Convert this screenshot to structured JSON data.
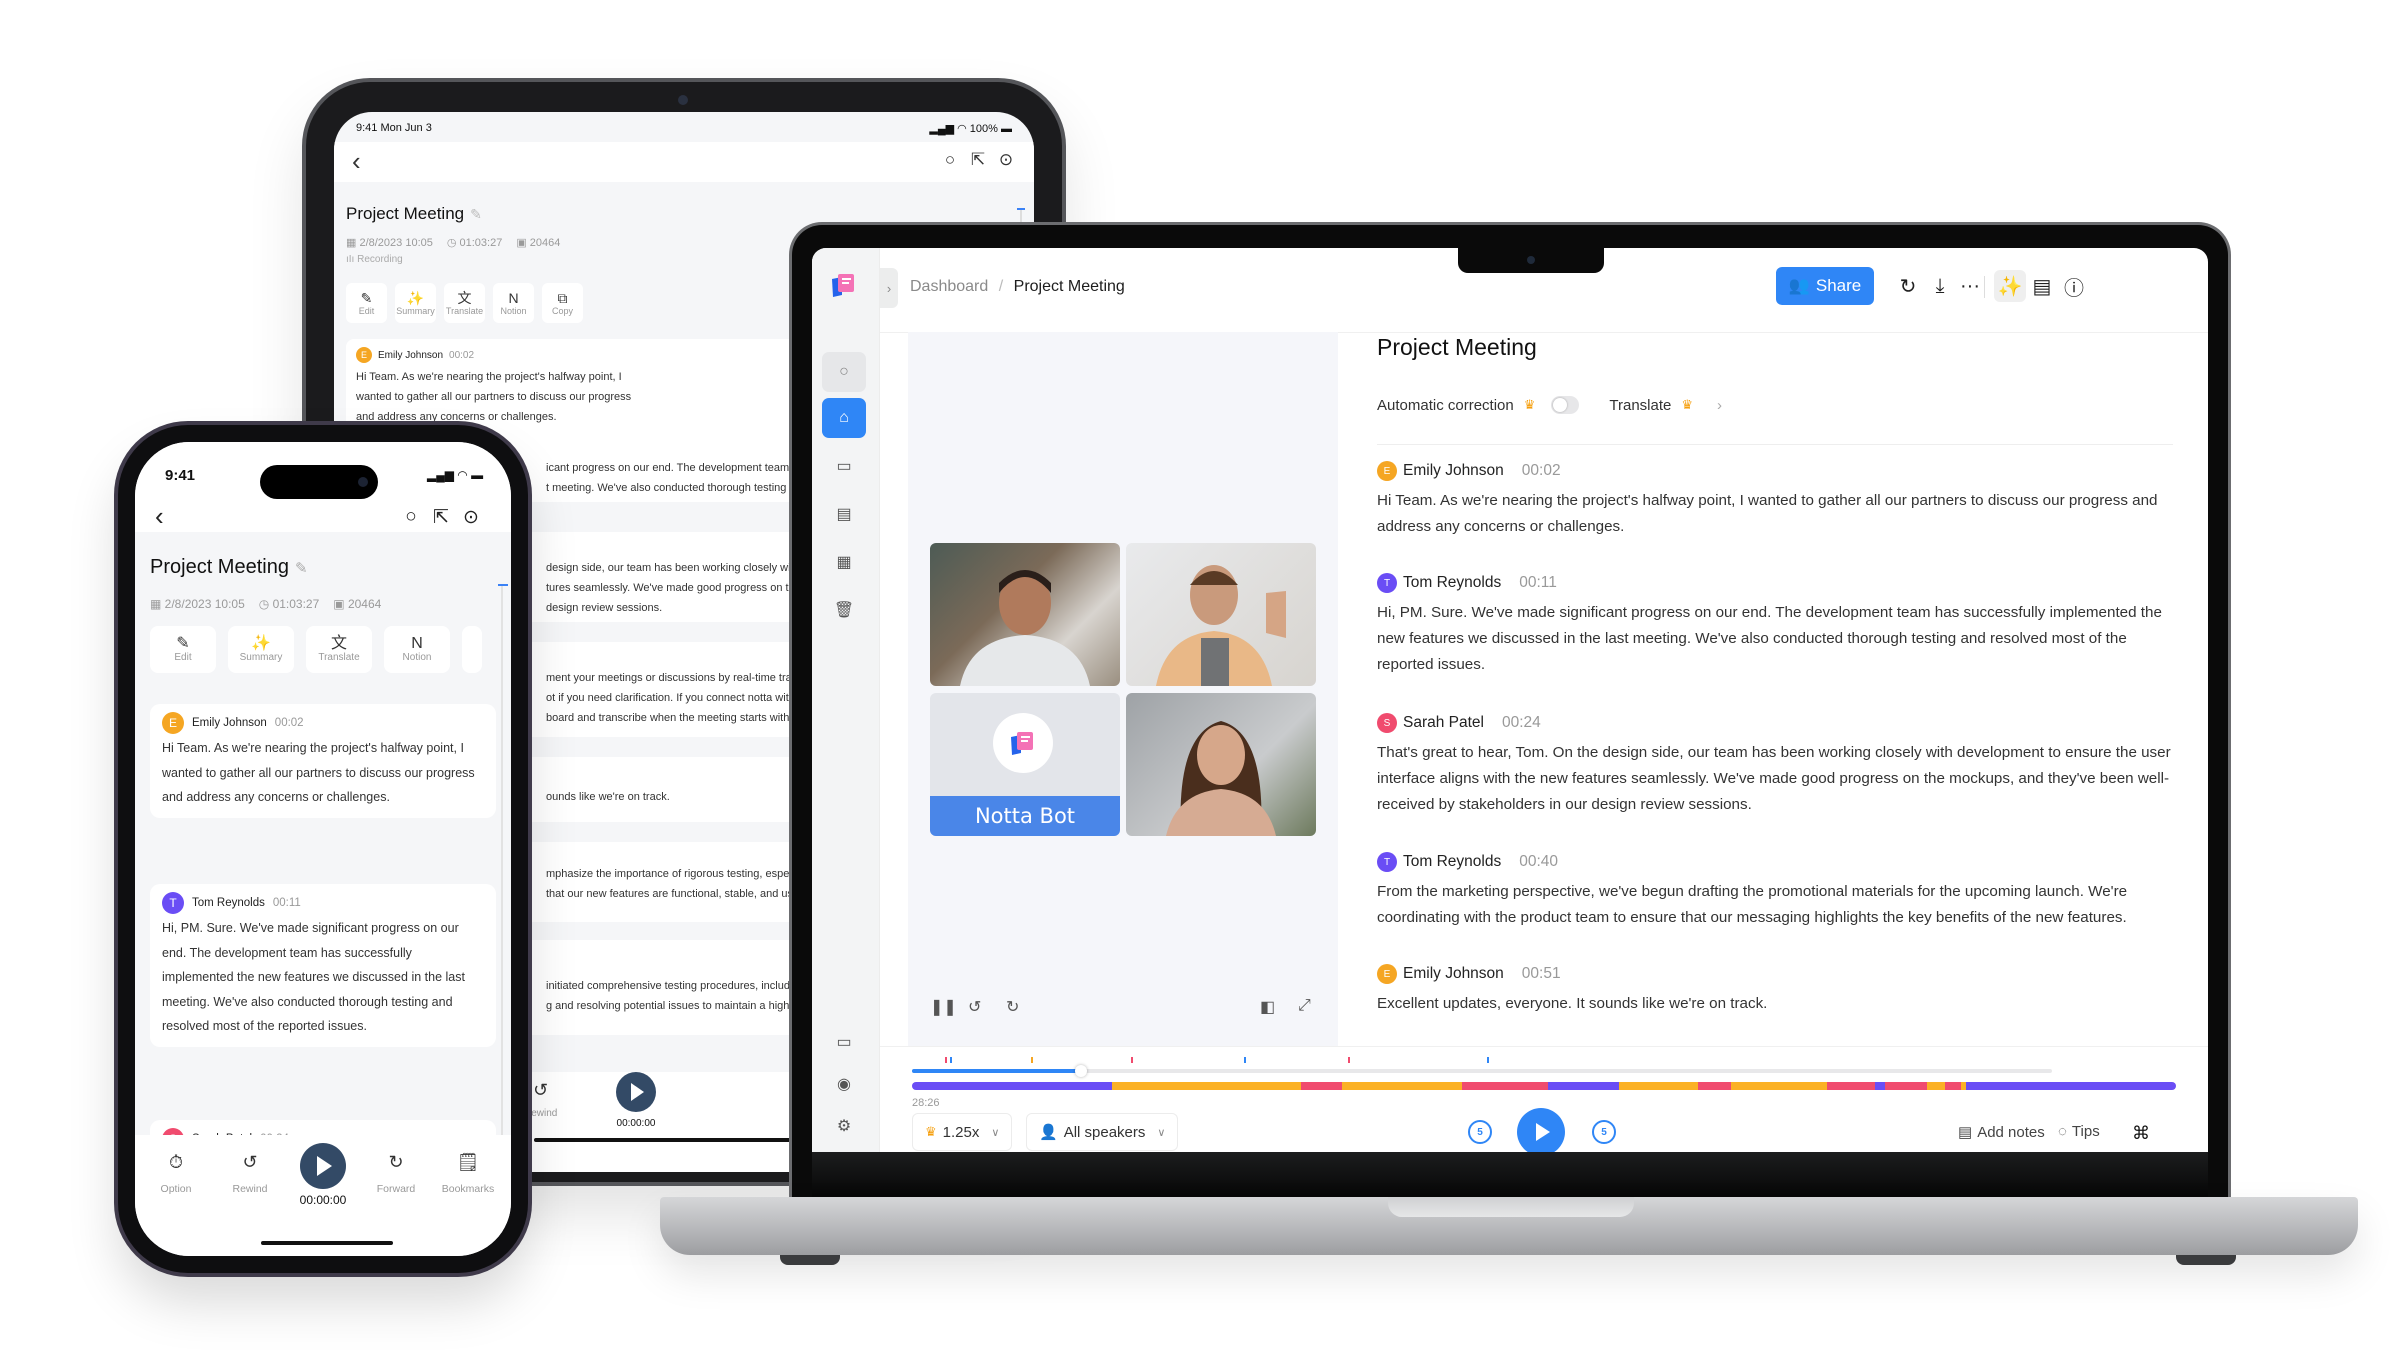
{
  "tablet": {
    "status_time": "9:41 Mon Jun 3",
    "status_battery": "100%",
    "title": "Project Meeting",
    "meta": {
      "date": "2/8/2023 10:05",
      "duration": "01:03:27",
      "words": "20464"
    },
    "recording_label": "Recording",
    "tools": [
      {
        "icon": "edit-icon",
        "glyph": "✎",
        "label": "Edit"
      },
      {
        "icon": "summary-icon",
        "glyph": "✨",
        "label": "Summary"
      },
      {
        "icon": "translate-icon",
        "glyph": "文",
        "label": "Translate"
      },
      {
        "icon": "notion-icon",
        "glyph": "N",
        "label": "Notion"
      },
      {
        "icon": "copy-icon",
        "glyph": "⧉",
        "label": "Copy"
      }
    ],
    "first_entry": {
      "speaker": "Emily Johnson",
      "initial": "E",
      "time": "00:02",
      "text": "Hi Team. As we're nearing the project's halfway point, I wanted to gather all our partners to discuss our progress and address any concerns or challenges."
    },
    "partial_lines": [
      "icant progress on our end. The development team has successfully implemented",
      "t meeting. We've also conducted thorough testing and resolved",
      "design side, our team has been working closely with development",
      "tures seamlessly. We've made good progress on the mockups",
      "design review sessions.",
      "ment your meetings or discussions by real-time transcription",
      "ot if you need clarification. If you connect notta with",
      "board and transcribe when the meeting starts with",
      "ounds like we're on track.",
      "mphasize the importance of rigorous testing, especially",
      " that our new features are functional, stable, and user-friendly",
      " initiated comprehensive testing procedures, including",
      "g and resolving potential issues to maintain a high-quality"
    ],
    "bottom": {
      "rewind_label": "Rewind",
      "time": "00:00:00"
    }
  },
  "phone": {
    "status_time": "9:41",
    "title": "Project Meeting",
    "meta": {
      "date": "2/8/2023 10:05",
      "duration": "01:03:27",
      "words": "20464"
    },
    "tools": [
      {
        "glyph": "✎",
        "label": "Edit"
      },
      {
        "glyph": "✨",
        "label": "Summary"
      },
      {
        "glyph": "文",
        "label": "Translate"
      },
      {
        "glyph": "N",
        "label": "Notion"
      }
    ],
    "entries": [
      {
        "speaker": "Emily Johnson",
        "initial": "E",
        "color": "#f5a623",
        "time": "00:02",
        "text": "Hi Team. As we're nearing the project's halfway point, I wanted to gather all our partners to discuss our progress and address any concerns or challenges."
      },
      {
        "speaker": "Tom Reynolds",
        "initial": "T",
        "color": "#6a4df5",
        "time": "00:11",
        "text": "Hi, PM. Sure. We've made significant progress on our end. The development team has successfully implemented the new features we discussed in the last meeting. We've also conducted thorough testing and resolved most of the reported issues."
      },
      {
        "speaker": "Sarah Patel",
        "initial": "S",
        "color": "#f04b6e",
        "time": "00:24",
        "text": "That's great to hear, Tom. On the design side, our team has been working closely with development"
      }
    ],
    "bottom": [
      {
        "glyph": "⏱",
        "label": "Option"
      },
      {
        "glyph": "↺",
        "label": "Rewind"
      },
      {
        "glyph": "",
        "label": "00:00:00"
      },
      {
        "glyph": "↻",
        "label": "Forward"
      },
      {
        "glyph": "🗒",
        "label": "Bookmarks"
      }
    ]
  },
  "laptop": {
    "breadcrumb": {
      "parent": "Dashboard",
      "separator": "/",
      "current": "Project Meeting"
    },
    "share_label": "Share",
    "toolbar_icons": [
      "search-replace-icon",
      "download-icon",
      "more-icon",
      "ai-magic-icon",
      "notes-icon",
      "help-icon"
    ],
    "sidebar_icons": [
      "search-icon",
      "home-icon",
      "folder-icon",
      "calendar-icon",
      "calendar-add-icon",
      "trash-icon",
      "feedback-icon",
      "idea-icon",
      "settings-icon"
    ],
    "video": {
      "bot_name": "Notta Bot"
    },
    "transcript": {
      "title": "Project Meeting",
      "auto_correction_label": "Automatic correction",
      "auto_correction_enabled": false,
      "translate_label": "Translate",
      "entries": [
        {
          "speaker": "Emily Johnson",
          "initial": "E",
          "color": "#f5a623",
          "time": "00:02",
          "text": "Hi Team. As we're nearing the project's halfway point, I wanted to gather all our partners to discuss our progress and address any concerns or challenges."
        },
        {
          "speaker": "Tom Reynolds",
          "initial": "T",
          "color": "#6a4df5",
          "time": "00:11",
          "text": "Hi, PM. Sure. We've made significant progress on our end. The development team has successfully implemented the new features we discussed in the last meeting. We've also conducted thorough testing and resolved most of the reported issues."
        },
        {
          "speaker": "Sarah Patel",
          "initial": "S",
          "color": "#f04b6e",
          "time": "00:24",
          "text": "That's great to hear, Tom. On the design side, our team has been working closely with development to ensure the user interface aligns with the new features seamlessly. We've made good progress on the mockups, and they've been well-received by stakeholders in our design review sessions."
        },
        {
          "speaker": "Tom Reynolds",
          "initial": "T",
          "color": "#6a4df5",
          "time": "00:40",
          "text": "From the marketing perspective, we've begun drafting the promotional materials for the upcoming launch. We're coordinating with the product team to ensure that our messaging highlights the key benefits of the new features."
        },
        {
          "speaker": "Emily Johnson",
          "initial": "E",
          "color": "#f5a623",
          "time": "00:51",
          "text": "Excellent updates, everyone. It sounds like we're on track."
        }
      ]
    },
    "player": {
      "current_time": "28:26",
      "progress_fraction": 0.148,
      "speed_label": "1.25x",
      "speakers_label": "All speakers",
      "skip_back_seconds": "5",
      "skip_forward_seconds": "5",
      "add_notes_label": "Add notes",
      "tips_label": "Tips",
      "shortcut_glyph": "⌘",
      "markers": [
        {
          "pos": 0.026,
          "color": "#f04b6e"
        },
        {
          "pos": 0.03,
          "color": "#2f86f6"
        },
        {
          "pos": 0.094,
          "color": "#f5a623"
        },
        {
          "pos": 0.173,
          "color": "#f04b6e"
        },
        {
          "pos": 0.263,
          "color": "#2f86f6"
        },
        {
          "pos": 0.345,
          "color": "#f04b6e"
        },
        {
          "pos": 0.455,
          "color": "#2f86f6"
        }
      ],
      "speaker_segments": [
        {
          "frac": 0.158,
          "color": "#6a4df5"
        },
        {
          "frac": 0.15,
          "color": "#fbb125"
        },
        {
          "frac": 0.032,
          "color": "#f04b6e"
        },
        {
          "frac": 0.095,
          "color": "#fbb125"
        },
        {
          "frac": 0.068,
          "color": "#f04b6e"
        },
        {
          "frac": 0.056,
          "color": "#6a4df5"
        },
        {
          "frac": 0.063,
          "color": "#fbb125"
        },
        {
          "frac": 0.026,
          "color": "#f04b6e"
        },
        {
          "frac": 0.076,
          "color": "#fbb125"
        },
        {
          "frac": 0.038,
          "color": "#f04b6e"
        },
        {
          "frac": 0.008,
          "color": "#6a4df5"
        },
        {
          "frac": 0.033,
          "color": "#f04b6e"
        },
        {
          "frac": 0.014,
          "color": "#fbb125"
        },
        {
          "frac": 0.013,
          "color": "#f04b6e"
        },
        {
          "frac": 0.004,
          "color": "#fbb125"
        },
        {
          "frac": 0.166,
          "color": "#6a4df5"
        }
      ]
    }
  }
}
